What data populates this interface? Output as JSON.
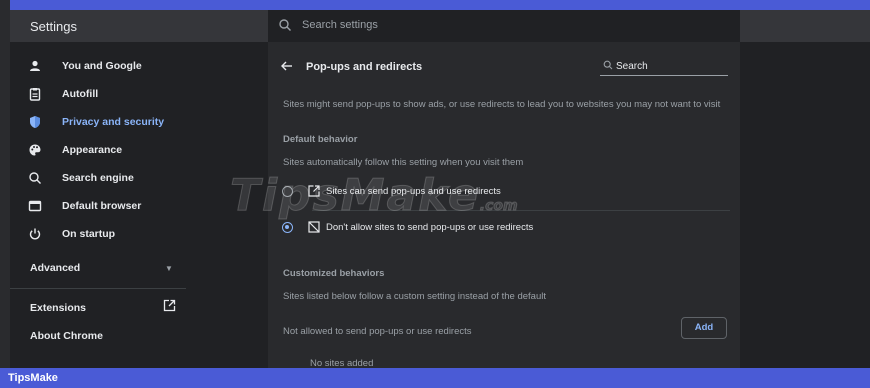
{
  "header": {
    "app_title": "Settings",
    "search_placeholder": "Search settings"
  },
  "sidebar": {
    "items": [
      {
        "label": "You and Google",
        "icon": "person-icon"
      },
      {
        "label": "Autofill",
        "icon": "clipboard-icon"
      },
      {
        "label": "Privacy and security",
        "icon": "shield-icon",
        "active": true
      },
      {
        "label": "Appearance",
        "icon": "palette-icon"
      },
      {
        "label": "Search engine",
        "icon": "search-icon"
      },
      {
        "label": "Default browser",
        "icon": "browser-window-icon"
      },
      {
        "label": "On startup",
        "icon": "power-icon"
      }
    ],
    "advanced_label": "Advanced",
    "extensions_label": "Extensions",
    "about_label": "About Chrome"
  },
  "main": {
    "title": "Pop-ups and redirects",
    "search_placeholder": "Search",
    "intro": "Sites might send pop-ups to show ads, or use redirects to lead you to websites you may not want to visit",
    "default_behavior": {
      "heading": "Default behavior",
      "description": "Sites automatically follow this setting when you visit them",
      "options": [
        {
          "label": "Sites can send pop-ups and use redirects",
          "selected": false,
          "icon": "open-in-new-icon"
        },
        {
          "label": "Don't allow sites to send pop-ups or use redirects",
          "selected": true,
          "icon": "blocked-popup-icon"
        }
      ]
    },
    "customized_behaviors": {
      "heading": "Customized behaviors",
      "description": "Sites listed below follow a custom setting instead of the default",
      "not_allowed_label": "Not allowed to send pop-ups or use redirects",
      "add_label": "Add",
      "empty_label": "No sites added"
    }
  },
  "watermark": {
    "text": "TipsMake",
    "suffix": ".com"
  },
  "footer": {
    "label": "TipsMake"
  },
  "colors": {
    "accent": "#8ab4f8",
    "frame": "#4a5bd6",
    "background": "#202124",
    "card": "#292a2d"
  }
}
